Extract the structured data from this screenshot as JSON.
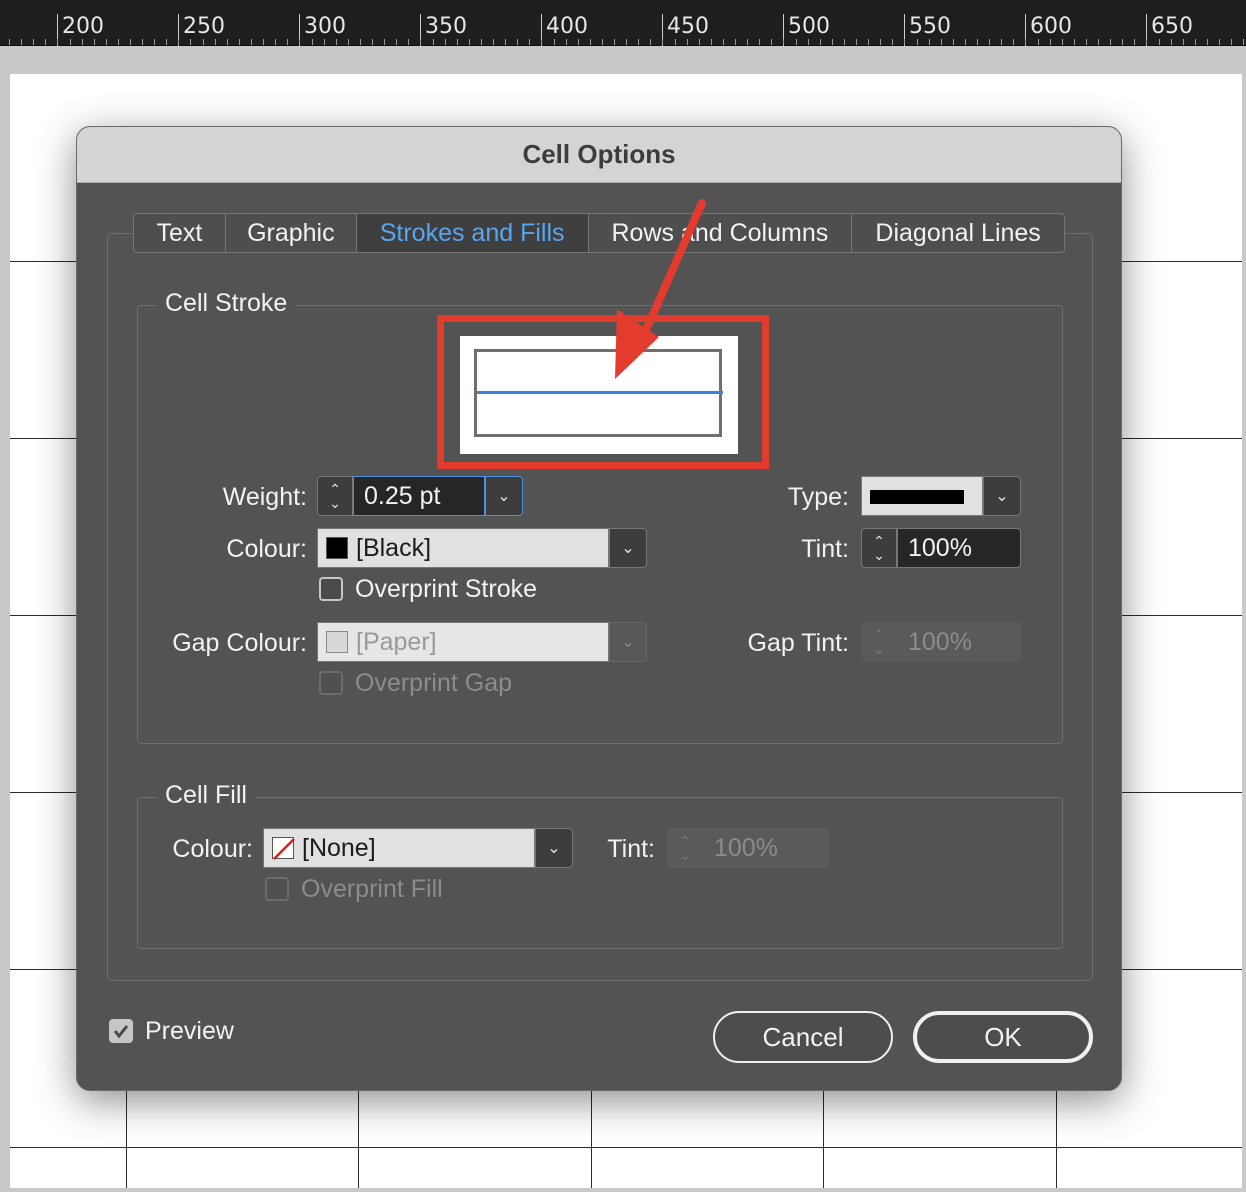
{
  "ruler": {
    "labels": [
      "200",
      "250",
      "300",
      "350",
      "400",
      "450",
      "500",
      "550",
      "600",
      "650"
    ]
  },
  "dialog": {
    "title": "Cell Options",
    "tabs": [
      {
        "label": "Text",
        "active": false
      },
      {
        "label": "Graphic",
        "active": false
      },
      {
        "label": "Strokes and Fills",
        "active": true
      },
      {
        "label": "Rows and Columns",
        "active": false
      },
      {
        "label": "Diagonal Lines",
        "active": false
      }
    ],
    "cell_stroke": {
      "group_label": "Cell Stroke",
      "weight_label": "Weight:",
      "weight_value": "0.25 pt",
      "type_label": "Type:",
      "colour_label": "Colour:",
      "colour_value": "[Black]",
      "tint_label": "Tint:",
      "tint_value": "100%",
      "overprint_stroke_label": "Overprint Stroke",
      "overprint_stroke_checked": false,
      "gap_colour_label": "Gap Colour:",
      "gap_colour_value": "[Paper]",
      "gap_tint_label": "Gap Tint:",
      "gap_tint_value": "100%",
      "overprint_gap_label": "Overprint Gap",
      "overprint_gap_checked": false
    },
    "cell_fill": {
      "group_label": "Cell Fill",
      "colour_label": "Colour:",
      "colour_value": "[None]",
      "tint_label": "Tint:",
      "tint_value": "100%",
      "overprint_fill_label": "Overprint Fill",
      "overprint_fill_checked": false
    },
    "preview_label": "Preview",
    "preview_checked": true,
    "cancel_label": "Cancel",
    "ok_label": "OK"
  },
  "colors": {
    "active_tab": "#57a6f0",
    "highlight": "#e33b2e",
    "dialog_bg": "#535353",
    "selected_stroke_line": "#3a83d6"
  }
}
